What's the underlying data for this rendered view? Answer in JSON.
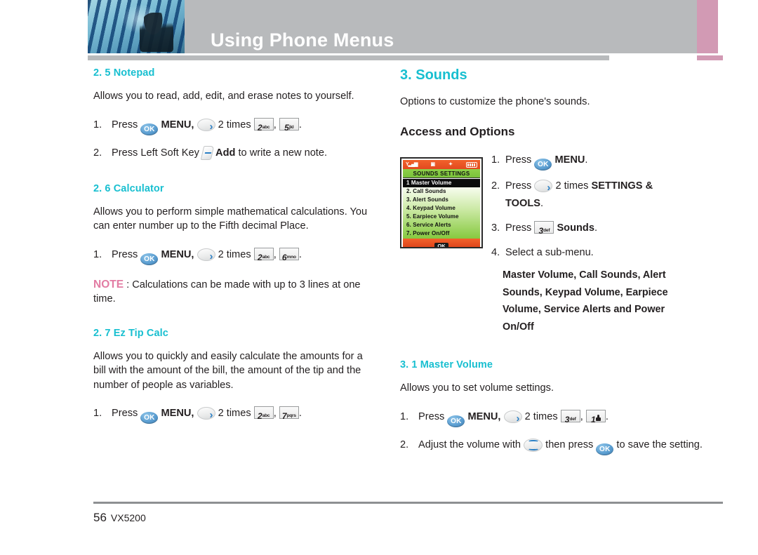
{
  "header": {
    "title": "Using Phone Menus",
    "photo_alt": "abstract-blue-photo"
  },
  "left_column": {
    "sections": [
      {
        "heading": "2. 5 Notepad",
        "body": "Allows you to read, add, edit, and erase notes to yourself.",
        "steps": [
          {
            "num": "1.",
            "pre": "Press",
            "ok": "OK",
            "menu": "MENU,",
            "nav": "nav-right-icon",
            "times": "2 times",
            "keys": [
              {
                "d": "2",
                "l": "abc"
              },
              {
                "d": "5",
                "l": "jkl"
              }
            ],
            "post": "."
          },
          {
            "num": "2.",
            "pre": "Press Left Soft Key",
            "softkey": "left-soft-key-icon",
            "bold": "Add",
            "post": "to write a new note."
          }
        ]
      },
      {
        "heading": "2. 6 Calculator",
        "body": "Allows you to perform simple mathematical calculations. You can enter number up to the Fifth decimal Place.",
        "steps": [
          {
            "num": "1.",
            "pre": "Press",
            "ok": "OK",
            "menu": "MENU,",
            "times": "2 times",
            "keys": [
              {
                "d": "2",
                "l": "abc"
              },
              {
                "d": "6",
                "l": "mno"
              }
            ],
            "post": "."
          }
        ],
        "note_label": "NOTE",
        "note_text": ": Calculations can be made with up to 3 lines at one time."
      },
      {
        "heading": "2. 7 Ez Tip Calc",
        "body": "Allows you to quickly and easily calculate the amounts for a bill with the amount of the bill, the amount of the tip and the number of people as variables.",
        "steps": [
          {
            "num": "1.",
            "pre": "Press",
            "ok": "OK",
            "menu": "MENU,",
            "times": "2 times",
            "keys": [
              {
                "d": "2",
                "l": "abc"
              },
              {
                "d": "7",
                "l": "pqrs"
              }
            ],
            "post": "."
          }
        ]
      }
    ]
  },
  "right_column": {
    "heading": "3. Sounds",
    "intro": "Options to customize the phone's sounds.",
    "subheading": "Access and Options",
    "phone_screen": {
      "status_icons": [
        "signal-icon",
        "message-icon",
        "bluetooth-icon",
        "battery-icon"
      ],
      "title": "SOUNDS SETTINGS",
      "items": [
        "1  Master Volume",
        "2. Call Sounds",
        "3. Alert Sounds",
        "4. Keypad Volume",
        "5. Earpiece Volume",
        "6. Service Alerts",
        "7. Power On/Off"
      ],
      "selected_index": 0,
      "softkey_label": "OK"
    },
    "steps": [
      {
        "num": "1.",
        "pre": "Press",
        "ok": "OK",
        "bold": "MENU",
        "post": "."
      },
      {
        "num": "2.",
        "pre": "Press",
        "nav": "nav-right-icon",
        "times": "2 times",
        "bold": "SETTINGS &",
        "bold2": "TOOLS",
        "post": "."
      },
      {
        "num": "3.",
        "pre": "Press",
        "keys": [
          {
            "d": "3",
            "l": "def"
          }
        ],
        "bold": "Sounds",
        "post": "."
      },
      {
        "num": "4.",
        "pre": "Select a sub-menu.",
        "post": ""
      }
    ],
    "submenu_lines": [
      "Master Volume, Call Sounds, Alert",
      "Sounds, Keypad Volume, Earpiece",
      "Volume, Service Alerts and Power",
      "On/Off"
    ],
    "master_volume": {
      "heading": "3. 1 Master Volume",
      "body": "Allows you to set volume settings.",
      "steps": [
        {
          "num": "1.",
          "pre": "Press",
          "ok": "OK",
          "menu": "MENU,",
          "times": "2 times",
          "keys": [
            {
              "d": "3",
              "l": "def"
            },
            {
              "d": "1",
              "l": "voicemail-icon"
            }
          ],
          "post": "."
        },
        {
          "num": "2.",
          "pre": "Adjust the volume with",
          "navud": "nav-up-down-icon",
          "mid": "then press",
          "ok": "OK",
          "post": "to save the setting."
        }
      ]
    }
  },
  "footer": {
    "page_number": "56",
    "model": "VX5200"
  },
  "colors": {
    "heading_teal": "#18bfd0",
    "header_gray": "#b8babc",
    "header_pink": "#d29ab4",
    "note_pink": "#e27ca3",
    "ok_blue": "#5b9ed1",
    "phone_orange": "#e2491f",
    "phone_green": "#79c23a",
    "body_text": "#231f20"
  }
}
